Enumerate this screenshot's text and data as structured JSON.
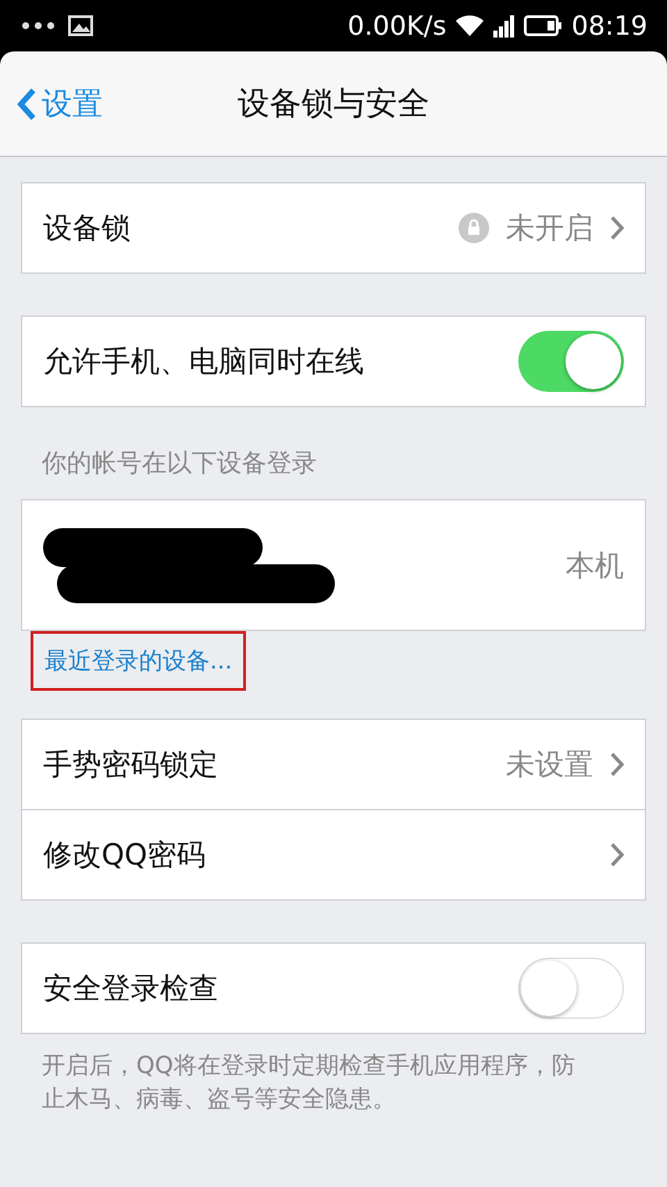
{
  "status_bar": {
    "speed": "0.00K/s",
    "time": "08:19"
  },
  "nav": {
    "back": "设置",
    "title": "设备锁与安全"
  },
  "groups": [
    {
      "rows": [
        {
          "kind": "value",
          "label": "设备锁",
          "value": "未开启",
          "lock": true,
          "chevron": true
        }
      ]
    },
    {
      "rows": [
        {
          "kind": "switch",
          "label": "允许手机、电脑同时在线",
          "on": true
        }
      ]
    },
    {
      "header": "你的帐号在以下设备登录",
      "rows": [
        {
          "kind": "device",
          "value": "本机"
        }
      ],
      "link": "最近登录的设备..."
    },
    {
      "rows": [
        {
          "kind": "value",
          "label": "手势密码锁定",
          "value": "未设置",
          "chevron": true
        },
        {
          "kind": "value",
          "label": "修改QQ密码",
          "chevron": true
        }
      ]
    },
    {
      "rows": [
        {
          "kind": "switch",
          "label": "安全登录检查",
          "on": false
        }
      ],
      "footer": "开启后，QQ将在登录时定期检查手机应用程序，防止木马、病毒、盗号等安全隐患。"
    }
  ]
}
